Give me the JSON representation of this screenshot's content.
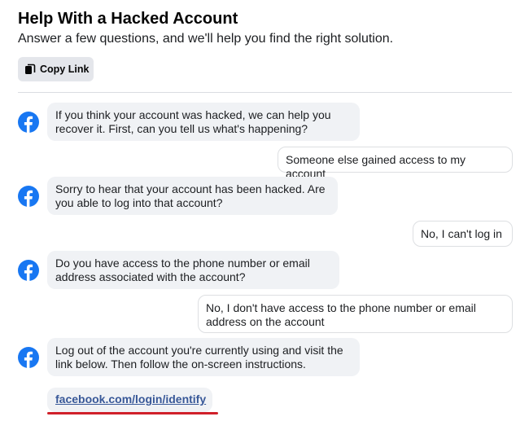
{
  "header": {
    "title": "Help With a Hacked Account",
    "subtitle": "Answer a few questions, and we'll help you find the right solution.",
    "copy_link_label": "Copy Link",
    "copy_icon": "copy-icon"
  },
  "colors": {
    "facebook_blue": "#1877f2",
    "link_blue": "#385898",
    "bot_bubble_bg": "#f0f2f5",
    "button_bg": "#e4e6eb",
    "highlight_red": "#d0202a"
  },
  "conversation": [
    {
      "from": "bot",
      "text": "If you think your account was hacked, we can help you recover it. First, can you tell us what's happening?"
    },
    {
      "from": "user",
      "text": "Someone else gained access to my account"
    },
    {
      "from": "bot",
      "text": "Sorry to hear that your account has been hacked. Are you able to log into that account?"
    },
    {
      "from": "user",
      "text": "No, I can't log in"
    },
    {
      "from": "bot",
      "text": "Do you have access to the phone number or email address associated with the account?"
    },
    {
      "from": "user",
      "text": "No, I don't have access to the phone number or email address on the account"
    },
    {
      "from": "bot",
      "text": "Log out of the account you're currently using and visit the link below. Then follow the on-screen instructions."
    }
  ],
  "link": {
    "text": "facebook.com/login/identify"
  }
}
